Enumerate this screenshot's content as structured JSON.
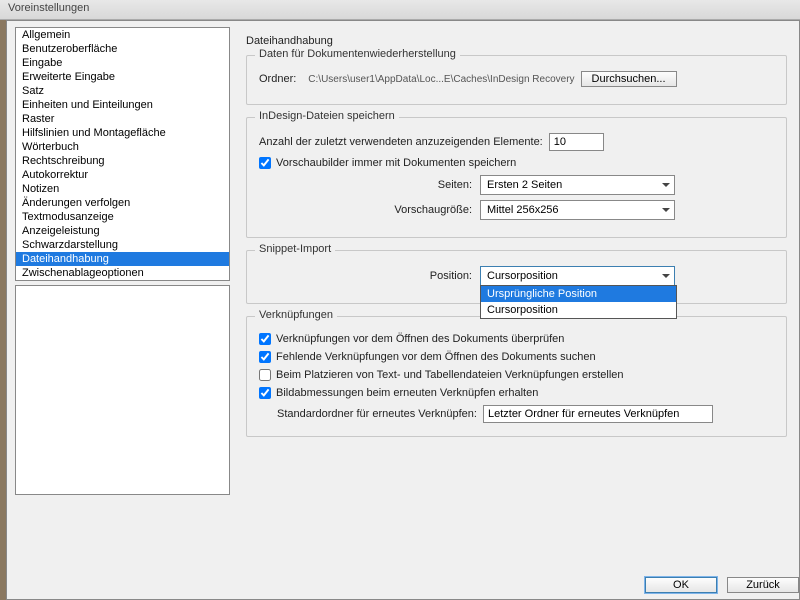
{
  "title": "Voreinstellungen",
  "sidebar": {
    "items": [
      {
        "label": "Allgemein"
      },
      {
        "label": "Benutzeroberfläche"
      },
      {
        "label": "Eingabe"
      },
      {
        "label": "Erweiterte Eingabe"
      },
      {
        "label": "Satz"
      },
      {
        "label": "Einheiten und Einteilungen"
      },
      {
        "label": "Raster"
      },
      {
        "label": "Hilfslinien und Montagefläche"
      },
      {
        "label": "Wörterbuch"
      },
      {
        "label": "Rechtschreibung"
      },
      {
        "label": "Autokorrektur"
      },
      {
        "label": "Notizen"
      },
      {
        "label": "Änderungen verfolgen"
      },
      {
        "label": "Textmodusanzeige"
      },
      {
        "label": "Anzeigeleistung"
      },
      {
        "label": "Schwarzdarstellung"
      },
      {
        "label": "Dateihandhabung"
      },
      {
        "label": "Zwischenablageoptionen"
      }
    ],
    "selected": "Dateihandhabung"
  },
  "main": {
    "title": "Dateihandhabung",
    "recovery": {
      "title": "Daten für Dokumentenwiederherstellung",
      "folder_label": "Ordner:",
      "folder_path": "C:\\Users\\user1\\AppData\\Loc...E\\Caches\\InDesign Recovery",
      "browse": "Durchsuchen..."
    },
    "save": {
      "title": "InDesign-Dateien speichern",
      "recent_label": "Anzahl der zuletzt verwendeten anzuzeigenden Elemente:",
      "recent_value": "10",
      "preview_check": "Vorschaubilder immer mit Dokumenten speichern",
      "pages_label": "Seiten:",
      "pages_value": "Ersten 2 Seiten",
      "size_label": "Vorschaugröße:",
      "size_value": "Mittel 256x256"
    },
    "snippet": {
      "title": "Snippet-Import",
      "pos_label": "Position:",
      "pos_value": "Cursorposition",
      "options": [
        "Ursprüngliche Position",
        "Cursorposition"
      ],
      "highlighted": "Ursprüngliche Position"
    },
    "links": {
      "title": "Verknüpfungen",
      "c1": "Verknüpfungen vor dem Öffnen des Dokuments überprüfen",
      "c2": "Fehlende Verknüpfungen vor dem Öffnen des Dokuments suchen",
      "c3": "Beim Platzieren von Text- und Tabellendateien Verknüpfungen erstellen",
      "c4": "Bildabmessungen beim erneuten Verknüpfen erhalten",
      "folder_label": "Standardordner für erneutes Verknüpfen:",
      "folder_value": "Letzter Ordner für erneutes Verknüpfen"
    }
  },
  "footer": {
    "ok": "OK",
    "cancel": "Zurück"
  }
}
